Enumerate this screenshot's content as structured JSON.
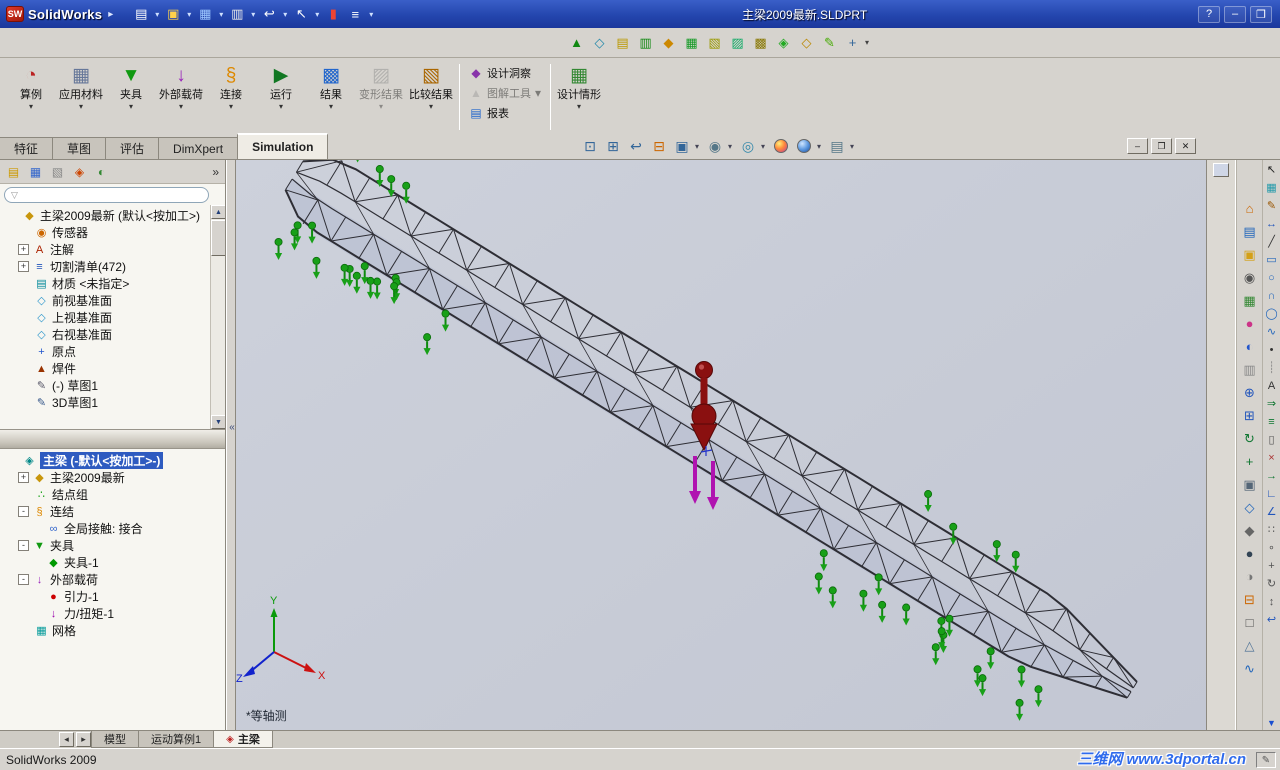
{
  "titlebar": {
    "app_name": "SolidWorks",
    "title": "主梁2009最新.SLDPRT",
    "tools": [
      "new-document",
      "open-document",
      "save",
      "print",
      "undo",
      "select-arrow",
      "color-swatch",
      "display-settings"
    ],
    "controls": {
      "help": "?",
      "minimize": "–",
      "maximize": "❐"
    }
  },
  "toolbar2": {
    "icons": [
      "3d-drawing-view",
      "reference-plane",
      "structural-member",
      "trim-extend",
      "gusset",
      "end-cap",
      "weld-bead",
      "extruded-boss",
      "extruded-cut",
      "fillet",
      "reference-geometry",
      "sketch",
      "customize"
    ]
  },
  "ribbon": {
    "buttons": [
      {
        "label": "算例",
        "icon": "study",
        "enabled": true
      },
      {
        "label": "应用材料",
        "icon": "apply-material",
        "enabled": true
      },
      {
        "label": "夹具",
        "icon": "fixtures",
        "enabled": true
      },
      {
        "label": "外部载荷",
        "icon": "external-loads",
        "enabled": true
      },
      {
        "label": "连接",
        "icon": "connections",
        "enabled": true
      },
      {
        "label": "运行",
        "icon": "run",
        "enabled": true
      },
      {
        "label": "结果",
        "icon": "results",
        "enabled": true
      },
      {
        "label": "变形结果",
        "icon": "deformed-result",
        "enabled": false
      },
      {
        "label": "比较结果",
        "icon": "compare-results",
        "enabled": true
      }
    ],
    "stack": [
      {
        "label": "设计洞察",
        "icon": "design-insight",
        "enabled": true,
        "dropdown": false
      },
      {
        "label": "图解工具",
        "icon": "plot-tools",
        "enabled": false,
        "dropdown": true
      },
      {
        "label": "报表",
        "icon": "report",
        "enabled": true,
        "dropdown": false
      }
    ],
    "scenario": {
      "label": "设计情形",
      "icon": "design-scenario",
      "enabled": true
    }
  },
  "command_tabs": [
    {
      "label": "特征",
      "name": "tab-features",
      "active": false
    },
    {
      "label": "草图",
      "name": "tab-sketch",
      "active": false
    },
    {
      "label": "评估",
      "name": "tab-evaluate",
      "active": false
    },
    {
      "label": "DimXpert",
      "name": "tab-dimxpert",
      "active": false
    },
    {
      "label": "Simulation",
      "name": "tab-simulation",
      "active": true
    }
  ],
  "headsup": [
    {
      "name": "zoom-to-fit",
      "dropdown": false
    },
    {
      "name": "zoom-to-area",
      "dropdown": false
    },
    {
      "name": "previous-view",
      "dropdown": false
    },
    {
      "name": "section-view",
      "dropdown": false
    },
    {
      "name": "view-orientation",
      "dropdown": true
    },
    {
      "name": "display-style",
      "dropdown": true
    },
    {
      "name": "hide-show-items",
      "dropdown": true
    },
    {
      "name": "edit-appearance",
      "dropdown": false
    },
    {
      "name": "apply-scene",
      "dropdown": true
    },
    {
      "name": "view-settings",
      "dropdown": true
    }
  ],
  "doc_controls": {
    "minimize": "–",
    "restore": "❐",
    "close": "✕"
  },
  "left_panel": {
    "tabs": [
      "feature-manager",
      "property-manager",
      "configuration-manager",
      "dimxpert-manager",
      "display-manager"
    ],
    "chevron": "»",
    "feature_tree": [
      {
        "label": "主梁2009最新 (默认<按加工>)",
        "icon": "part",
        "indent": 0
      },
      {
        "label": "传感器",
        "icon": "sensors",
        "indent": 1
      },
      {
        "label": "注解",
        "icon": "annotations",
        "expand": "+",
        "indent": 1
      },
      {
        "label": "切割清单(472)",
        "icon": "cut-list",
        "expand": "+",
        "indent": 1
      },
      {
        "label": "材质 <未指定>",
        "icon": "material",
        "indent": 1
      },
      {
        "label": "前视基准面",
        "icon": "plane",
        "indent": 1
      },
      {
        "label": "上视基准面",
        "icon": "plane",
        "indent": 1
      },
      {
        "label": "右视基准面",
        "icon": "plane",
        "indent": 1
      },
      {
        "label": "原点",
        "icon": "origin",
        "indent": 1
      },
      {
        "label": "焊件",
        "icon": "weldment",
        "indent": 1
      },
      {
        "label": "(-) 草图1",
        "icon": "sketch",
        "indent": 1
      },
      {
        "label": "3D草图1",
        "icon": "sketch-3d",
        "indent": 1
      }
    ],
    "study_tree": [
      {
        "label": "主梁 (-默认<按加工>-)",
        "icon": "simulation-study",
        "indent": 0,
        "selected": true
      },
      {
        "label": "主梁2009最新",
        "icon": "part",
        "expand": "+",
        "indent": 1
      },
      {
        "label": "结点组",
        "icon": "joint-group",
        "indent": 1
      },
      {
        "label": "连结",
        "icon": "connections",
        "expand": "-",
        "indent": 1
      },
      {
        "label": "全局接触: 接合",
        "icon": "global-contact",
        "indent": 2
      },
      {
        "label": "夹具",
        "icon": "fixtures",
        "expand": "-",
        "indent": 1
      },
      {
        "label": "夹具-1",
        "icon": "fixture",
        "indent": 2
      },
      {
        "label": "外部载荷",
        "icon": "external-loads",
        "expand": "-",
        "indent": 1
      },
      {
        "label": "引力-1",
        "icon": "gravity",
        "indent": 2
      },
      {
        "label": "力/扭矩-1",
        "icon": "force-torque",
        "indent": 2
      },
      {
        "label": "网格",
        "icon": "mesh",
        "indent": 1
      }
    ]
  },
  "viewport": {
    "view_label": "*等轴测",
    "triad": {
      "x": "X",
      "y": "Y",
      "z": "Z"
    }
  },
  "right_rail": {
    "taskpane_icons": [
      "solidworks-resources",
      "design-library",
      "file-explorer",
      "search",
      "view-palette",
      "appearances",
      "scene",
      "custom-properties",
      "zoom-fit",
      "zoom-area",
      "rotate-view",
      "pan-view",
      "standard-views",
      "wireframe",
      "hidden-lines",
      "shaded",
      "shadows",
      "section-view",
      "camera",
      "perspective",
      "curvature"
    ],
    "toolbar_icons": [
      "select-arrow",
      "grid-system",
      "sketch",
      "smart-dimension",
      "line",
      "rectangle",
      "circle",
      "arc",
      "ellipse",
      "spline",
      "point",
      "centerline",
      "text",
      "convert-entities",
      "offset-entities",
      "mirror-entities",
      "trim-entities",
      "extend-entities",
      "sketch-fillet",
      "sketch-chamfer",
      "linear-pattern",
      "circular-pattern",
      "move-entities",
      "rotate-entities",
      "scale-entities",
      "undo"
    ]
  },
  "bottom_tabs": {
    "tabs": [
      {
        "label": "模型",
        "name": "tab-model",
        "active": false
      },
      {
        "label": "运动算例1",
        "name": "tab-motion-study-1",
        "active": false
      },
      {
        "label": "主梁",
        "name": "tab-study-main-beam",
        "active": true,
        "icon": "study-tab"
      }
    ]
  },
  "statusbar": {
    "left": "SolidWorks 2009",
    "watermark": "三维网 www.3dportal.cn"
  }
}
